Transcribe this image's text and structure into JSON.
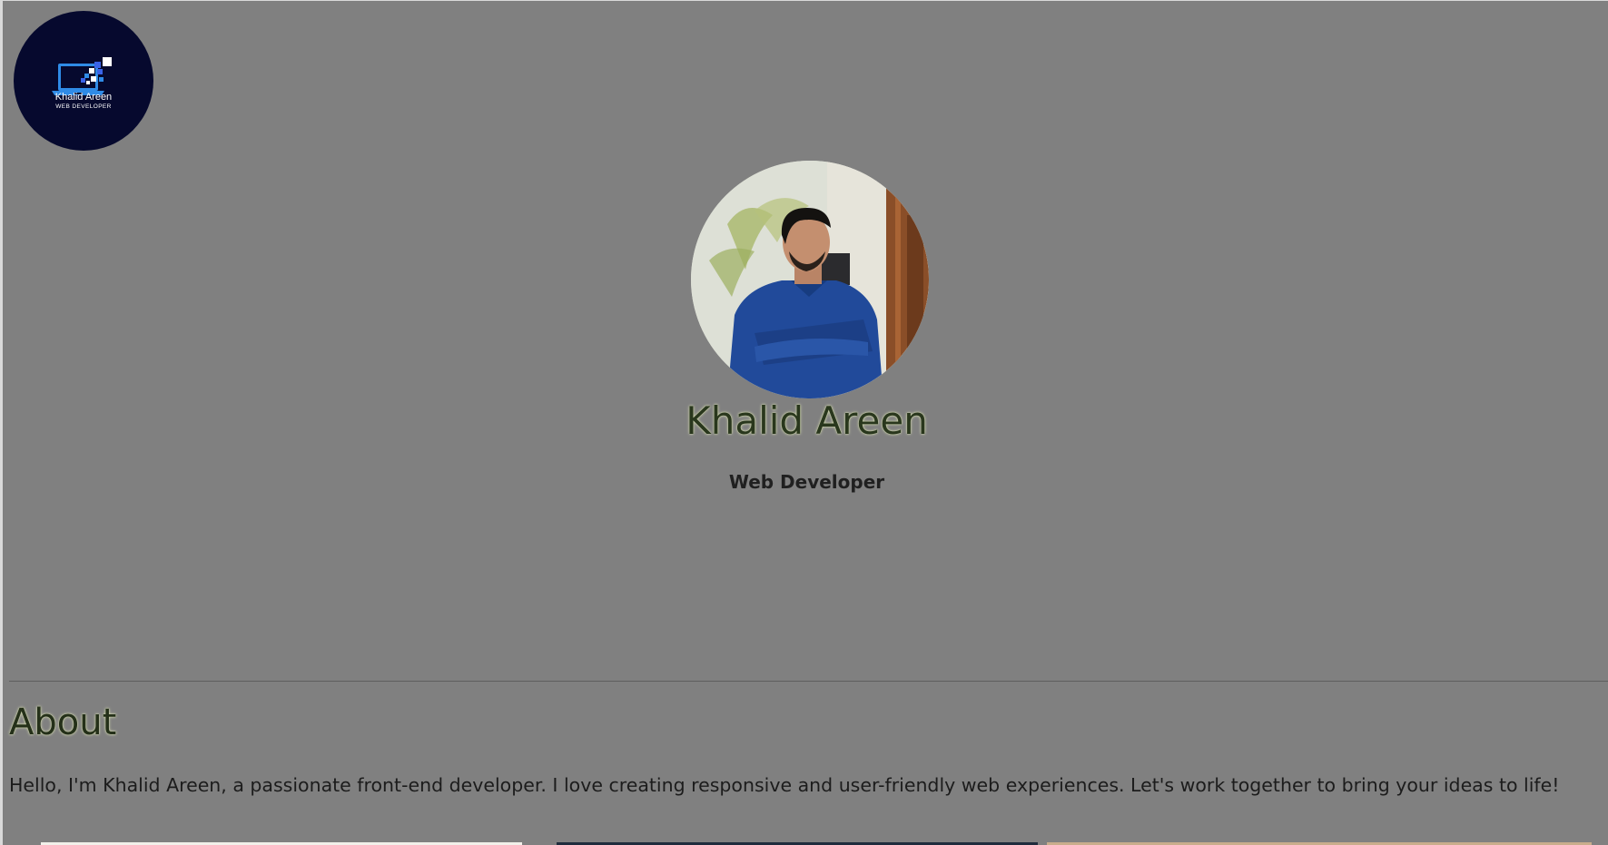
{
  "logo": {
    "name": "Khalid Areen",
    "role": "WEB DEVELOPER",
    "icon": "laptop-pixels-icon",
    "bg_color": "#06092e",
    "accent_color": "#2f7fe0"
  },
  "hero": {
    "photo_alt": "Khalid Areen",
    "name": "Khalid Areen",
    "role": "Web Developer"
  },
  "about": {
    "title": "About",
    "text": "Hello, I'm Khalid Areen, a passionate front-end developer. I love creating responsive and user-friendly web experiences. Let's work together to bring your ideas to life!"
  },
  "colors": {
    "page_bg": "#808080",
    "heading_glow": "#dfe6b6",
    "heading_text": "#29371d"
  }
}
